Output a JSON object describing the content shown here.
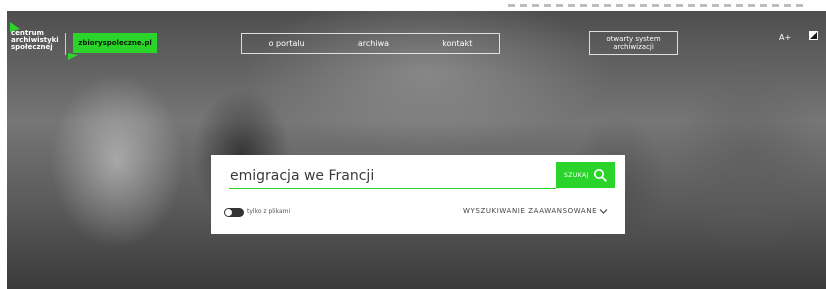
{
  "header": {
    "logo_lines": [
      "centrum",
      "archiwistyki",
      "społecznej"
    ],
    "zbiory_label": "zbioryspoleczne.pl",
    "nav": [
      "o portalu",
      "archiwa",
      "kontakt"
    ],
    "system_label_line1": "otwarty system",
    "system_label_line2": "archiwizacji",
    "font_size_label": "A+",
    "contrast_icon": "contrast-icon"
  },
  "search": {
    "query": "emigracja we Francji",
    "button_label": "SZUKAJ",
    "toggle_label": "tylko z plikami",
    "toggle_on": false,
    "advanced_label": "WYSZUKIWANIE ZAAWANSOWANE"
  },
  "colors": {
    "accent": "#2bd42b",
    "text_dark": "#3a3a3a"
  }
}
